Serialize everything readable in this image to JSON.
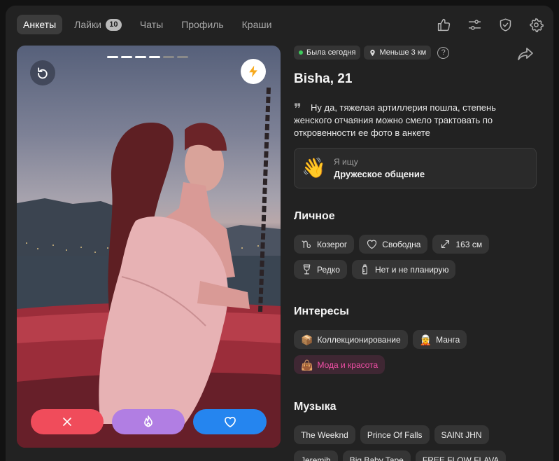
{
  "nav": {
    "tabs": [
      {
        "label": "Анкеты",
        "active": true
      },
      {
        "label": "Лайки",
        "badge": "10"
      },
      {
        "label": "Чаты"
      },
      {
        "label": "Профиль"
      },
      {
        "label": "Краши"
      }
    ],
    "icons": [
      "thumbs-up-icon",
      "filters-icon",
      "shield-check-icon",
      "settings-gear-icon"
    ]
  },
  "photo": {
    "progress": {
      "total": 6,
      "current": 4
    },
    "colors": {
      "active_dot": "#ffffff",
      "inactive_dot": "#8a8a8a",
      "bolt": "#f7a91c"
    },
    "actions": [
      {
        "name": "dislike",
        "color": "#f04c5b"
      },
      {
        "name": "super-like",
        "color": "#b17ee3"
      },
      {
        "name": "like",
        "color": "#2585ef"
      }
    ]
  },
  "profile": {
    "status": "Была сегодня",
    "distance": "Меньше 3 км",
    "help": "?",
    "name": "Bisha, 21",
    "quote_mark": "❞",
    "bio": "Ну да, тяжелая артиллерия пошла, степень женского отчаяния можно смело трактовать по откровенности ее фото в анкете",
    "looking_for": {
      "emoji": "👋",
      "label": "Я ищу",
      "value": "Дружеское общение"
    }
  },
  "personal": {
    "title": "Личное",
    "row1": [
      {
        "icon": "capricorn-icon",
        "label": "Козерог"
      },
      {
        "icon": "heart-outline-icon",
        "label": "Свободна"
      },
      {
        "icon": "height-arrows-icon",
        "label": "163 см"
      }
    ],
    "row2": [
      {
        "icon": "wine-glass-icon",
        "label": "Редко"
      },
      {
        "icon": "baby-bottle-icon",
        "label": "Нет и не планирую"
      }
    ]
  },
  "interests": {
    "title": "Интересы",
    "row1": [
      {
        "emoji": "📦",
        "label": "Коллекционирование"
      },
      {
        "emoji": "🧝",
        "label": "Манга"
      }
    ],
    "row2": [
      {
        "emoji": "👜",
        "label": "Мода и красота",
        "highlight": true
      }
    ],
    "highlight_color": "#f24fa7"
  },
  "music": {
    "title": "Музыка",
    "row1": [
      "The Weeknd",
      "Prince Of Falls",
      "SAINt JHN"
    ],
    "row2": [
      "Jeremih",
      "Big Baby Tape",
      "FREE FLOW FLAVA"
    ]
  }
}
